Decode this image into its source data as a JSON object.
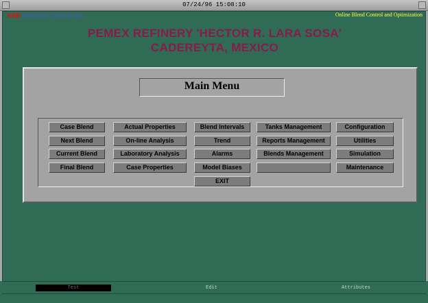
{
  "window": {
    "timestamp": "07/24/96 15:08:10"
  },
  "header": {
    "logo_abb": "ABB",
    "logo_company": "Industrial Systems Inc.",
    "app_title": "Online Blend Control and Optimization",
    "refinery_line1": "PEMEX REFINERY 'HECTOR R. LARA SOSA'",
    "refinery_line2": "CADEREYTA, MEXICO"
  },
  "menu": {
    "title": "Main Menu",
    "col1": [
      "Case Blend",
      "Next Blend",
      "Current Blend",
      "Final Blend"
    ],
    "col2": [
      "Actual Properties",
      "On-line Analysis",
      "Laboratory Analysis",
      "Case Properties"
    ],
    "col3": [
      "Blend Intervals",
      "Trend",
      "Alarms",
      "Model Biases",
      "EXIT"
    ],
    "col4": [
      "Tanks Management",
      "Reports Management",
      "Blends Management",
      ""
    ],
    "col5": [
      "Configuration",
      "Utilities",
      "Simulation",
      "Maintenance"
    ]
  },
  "bottom_tabs": {
    "test": "Test",
    "edit": "Edit",
    "attributes": "Attributes"
  },
  "colors": {
    "background": "#2f6b55",
    "heading": "#8a1a4c",
    "app_title": "#ffff40",
    "button": "#7c7c7c"
  }
}
